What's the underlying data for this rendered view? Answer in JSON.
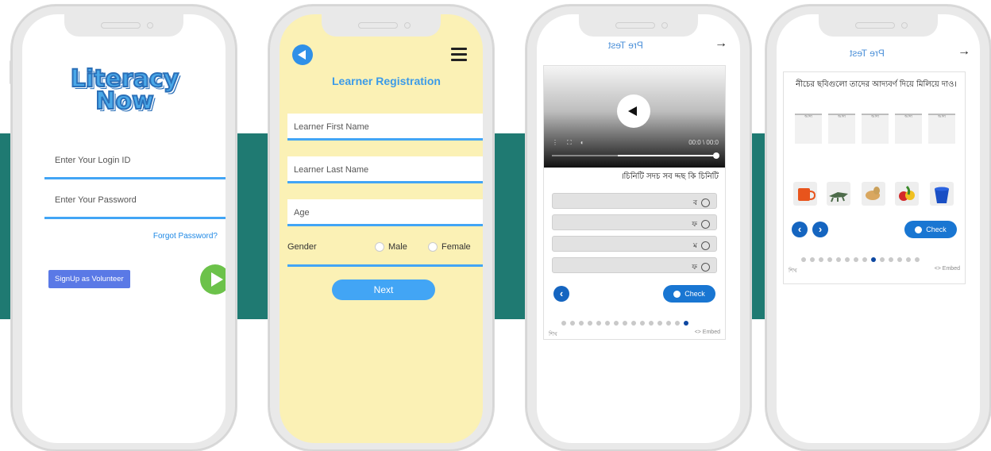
{
  "colors": {
    "teal_band": "#1f7a72",
    "accent_blue": "#42a5f5",
    "registration_bg": "#fbf1b5",
    "play_green": "#6cc24a"
  },
  "login": {
    "logo_line1": "Literacy",
    "logo_line2": "Now",
    "login_id_placeholder": "Enter Your Login ID",
    "password_placeholder": "Enter Your Password",
    "forgot_password": "Forgot Password?",
    "signup_volunteer": "SignUp as Volunteer",
    "go_icon": "play-circle-icon"
  },
  "registration": {
    "back_icon": "back-arrow-icon",
    "menu_icon": "hamburger-menu-icon",
    "title": "Learner Registration",
    "first_name_placeholder": "Learner First Name",
    "last_name_placeholder": "Learner Last Name",
    "age_placeholder": "Age",
    "gender_label": "Gender",
    "gender_options": [
      "Male",
      "Female"
    ],
    "next_label": "Next"
  },
  "pretest_audio": {
    "title": "Pre Test",
    "forward_icon": "→",
    "video_time": "00:0 \\ 00:0",
    "question": "।চিনিটি সদচ সব দ্দছ কি চিনিটি",
    "options": [
      "ব",
      "ফ",
      "ম",
      "ফ"
    ],
    "check_label": "Check",
    "footer_left": "<> Embed",
    "footer_right": "শিখ",
    "dots_total": 15,
    "dots_active": 14
  },
  "pretest_match": {
    "title": "Pre Test",
    "forward_icon": "→",
    "question": "নীচের ছবিগুলো তাদের আদ্যবর্ণ দিয়ে মিলিয়ে দাও।",
    "slot_labels": [
      "আদ্য",
      "আদ্য",
      "আদ্য",
      "আদ্য",
      "আদ্য"
    ],
    "items": [
      "mug",
      "crocodile",
      "ginger",
      "fruit",
      "bucket"
    ],
    "check_label": "Check",
    "footer_left": "<> Embed",
    "footer_right": "শিখ",
    "dots_total": 14,
    "dots_active": 8
  }
}
